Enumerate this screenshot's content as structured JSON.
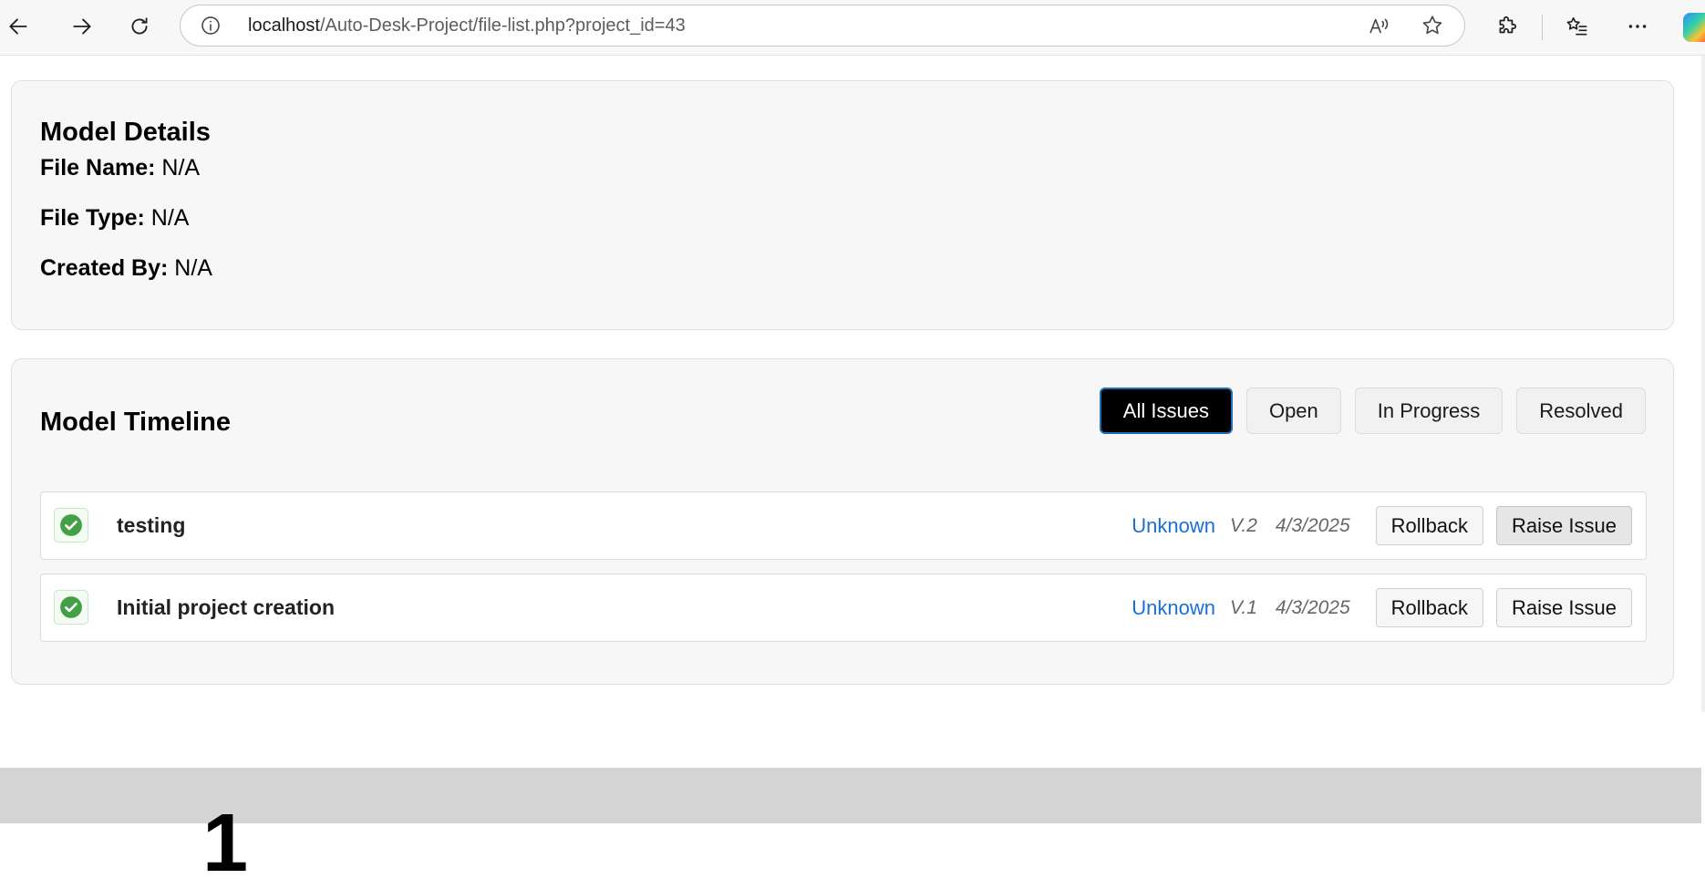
{
  "browser": {
    "url_host": "localhost",
    "url_path": "/Auto-Desk-Project/file-list.php?project_id=43",
    "icons": {
      "back": "back-arrow-icon",
      "forward": "forward-arrow-icon",
      "refresh": "refresh-icon",
      "info": "info-icon",
      "read_aloud": "read-aloud-icon",
      "favorite": "star-icon",
      "extensions": "puzzle-icon",
      "favorites_list": "favorites-list-icon",
      "more": "ellipsis-icon",
      "copilot": "copilot-icon"
    }
  },
  "model_details": {
    "title": "Model Details",
    "fields": [
      {
        "label": "File Name:",
        "value": "N/A"
      },
      {
        "label": "File Type:",
        "value": "N/A"
      },
      {
        "label": "Created By:",
        "value": "N/A"
      }
    ]
  },
  "model_timeline": {
    "title": "Model Timeline",
    "filters": [
      {
        "label": "All Issues",
        "active": true
      },
      {
        "label": "Open",
        "active": false
      },
      {
        "label": "In Progress",
        "active": false
      },
      {
        "label": "Resolved",
        "active": false
      }
    ],
    "items": [
      {
        "title": "testing",
        "user": "Unknown",
        "version": "V.2",
        "date": "4/3/2025",
        "rollback_label": "Rollback",
        "raise_label": "Raise Issue"
      },
      {
        "title": "Initial project creation",
        "user": "Unknown",
        "version": "V.1",
        "date": "4/3/2025",
        "rollback_label": "Rollback",
        "raise_label": "Raise Issue"
      }
    ]
  },
  "footer": {
    "glyph": "1"
  },
  "colors": {
    "accent_link": "#1a6fd6",
    "active_filter_bg": "#000000",
    "active_filter_border": "#1d6fb8",
    "success_green": "#43a047",
    "card_bg": "#f7f7f7"
  }
}
